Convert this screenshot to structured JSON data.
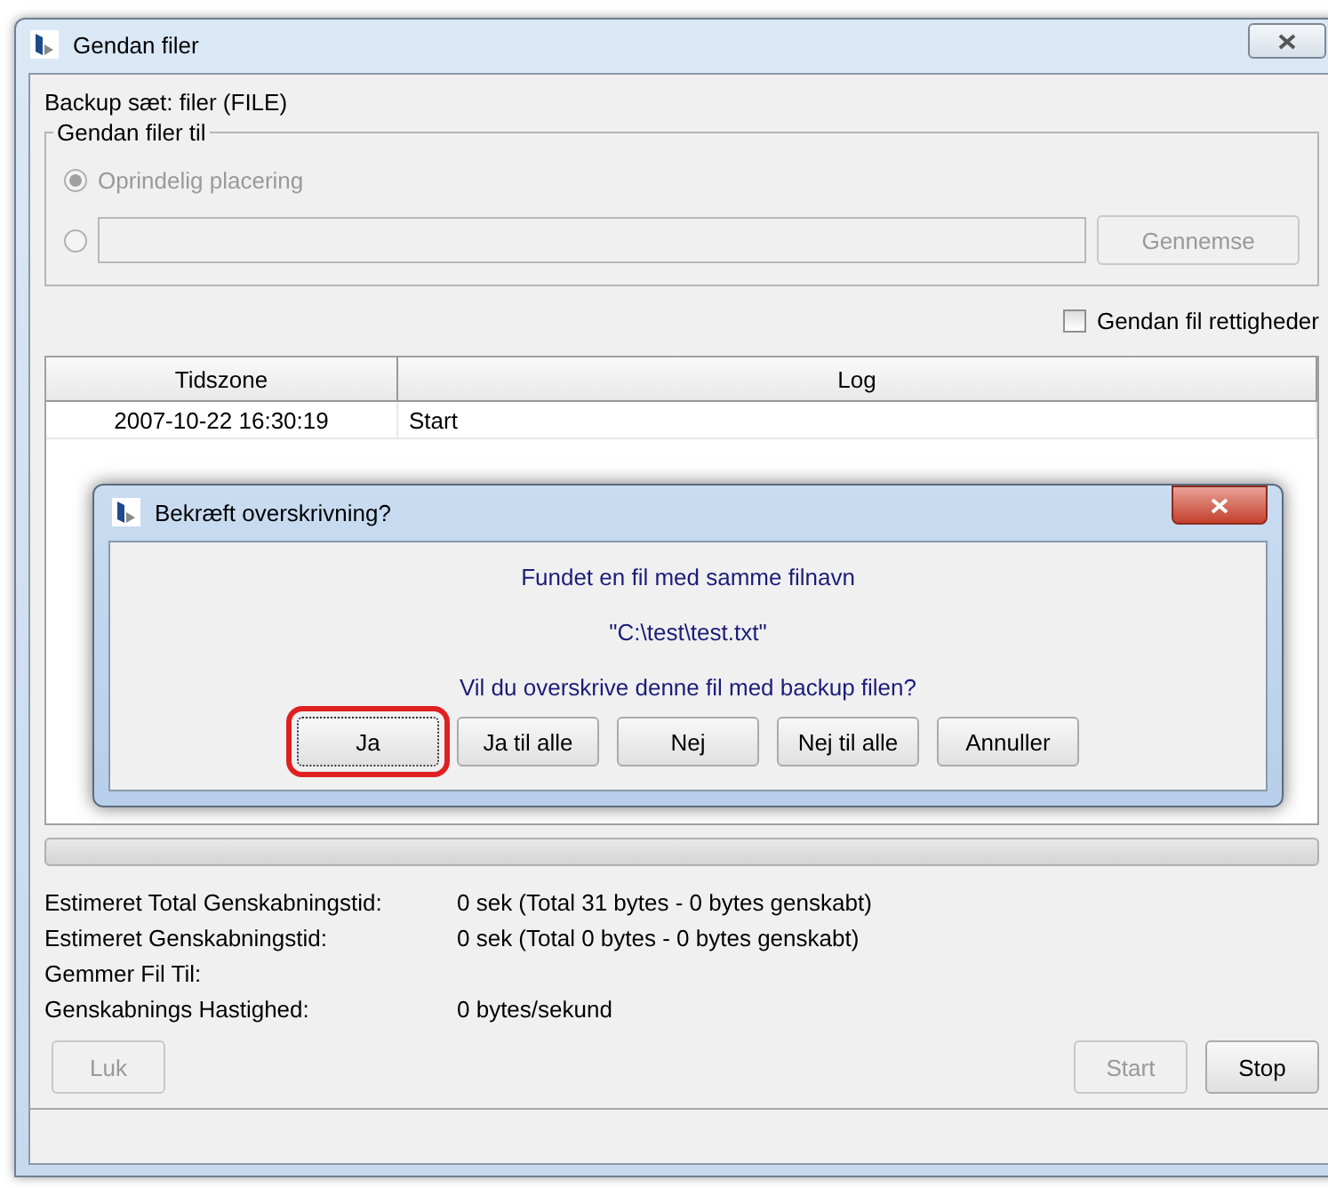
{
  "window": {
    "title": "Gendan filer"
  },
  "backup_set": "Backup sæt: filer (FILE)",
  "restore_to": {
    "legend": "Gendan filer til",
    "options": [
      {
        "label": "Oprindelig placering",
        "selected": true,
        "disabled": true
      },
      {
        "kind": "path",
        "selected": false,
        "disabled": true,
        "button": "Gennemse"
      }
    ]
  },
  "restore_permissions": {
    "label": "Gendan fil rettigheder",
    "checked": false
  },
  "log_table": {
    "columns": [
      "Tidszone",
      "Log"
    ],
    "rows": [
      [
        "2007-10-22 16:30:19",
        "Start"
      ]
    ]
  },
  "progress": {
    "level": 0
  },
  "stats": [
    {
      "label": "Estimeret Total Genskabningstid:",
      "value": "0 sek (Total 31 bytes - 0 bytes genskabt)"
    },
    {
      "label": "Estimeret Genskabningstid:",
      "value": "0 sek (Total 0 bytes - 0 bytes genskabt)"
    },
    {
      "label": "Gemmer Fil Til:"
    },
    {
      "label": "Genskabnings Hastighed:",
      "value": "0 bytes/sekund"
    }
  ],
  "buttons_left": [
    {
      "label": "Luk",
      "disabled": true
    }
  ],
  "buttons_right": [
    {
      "label": "Start",
      "disabled": true
    },
    {
      "label": "Stop",
      "disabled": false
    }
  ],
  "dialog": {
    "title": "Bekræft overskrivning?",
    "lines": [
      "Fundet en fil med samme filnavn",
      "\"C:\\test\\test.txt\"",
      "Vil du overskrive denne fil med backup filen?"
    ],
    "buttons": [
      {
        "label": "Ja",
        "highlighted": true
      },
      {
        "label": "Ja til alle",
        "highlighted": false
      },
      {
        "label": "Nej",
        "highlighted": false
      },
      {
        "label": "Nej til alle",
        "highlighted": false
      },
      {
        "label": "Annuller",
        "highlighted": false
      }
    ]
  }
}
